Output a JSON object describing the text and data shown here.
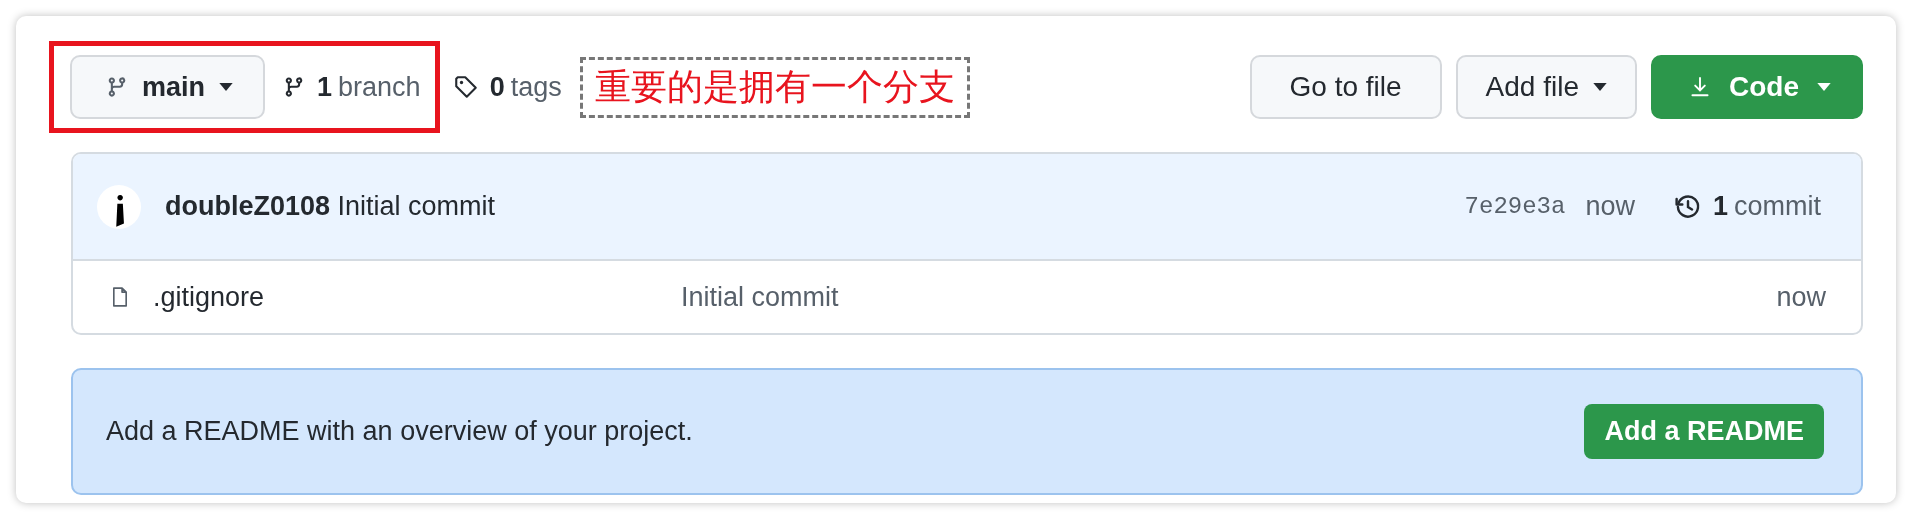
{
  "toolbar": {
    "branch_button": {
      "label": "main"
    },
    "branches": {
      "count": "1",
      "label": "branch"
    },
    "tags": {
      "count": "0",
      "label": "tags"
    },
    "annotation": "重要的是拥有一个分支",
    "buttons": [
      {
        "kind": "plain",
        "label": "Go to file",
        "dropdown": false
      },
      {
        "kind": "plain",
        "label": "Add file",
        "dropdown": true
      },
      {
        "kind": "primary",
        "label": "Code",
        "dropdown": true
      }
    ]
  },
  "latest_commit": {
    "author": "doubleZ0108",
    "message": "Initial commit",
    "sha": "7e29e3a",
    "time": "now",
    "commit_count": "1",
    "commit_label": "commit"
  },
  "files": [
    {
      "name": ".gitignore",
      "message": "Initial commit",
      "time": "now"
    }
  ],
  "readme_banner": {
    "text": "Add a README with an overview of your project.",
    "button": "Add a README"
  }
}
